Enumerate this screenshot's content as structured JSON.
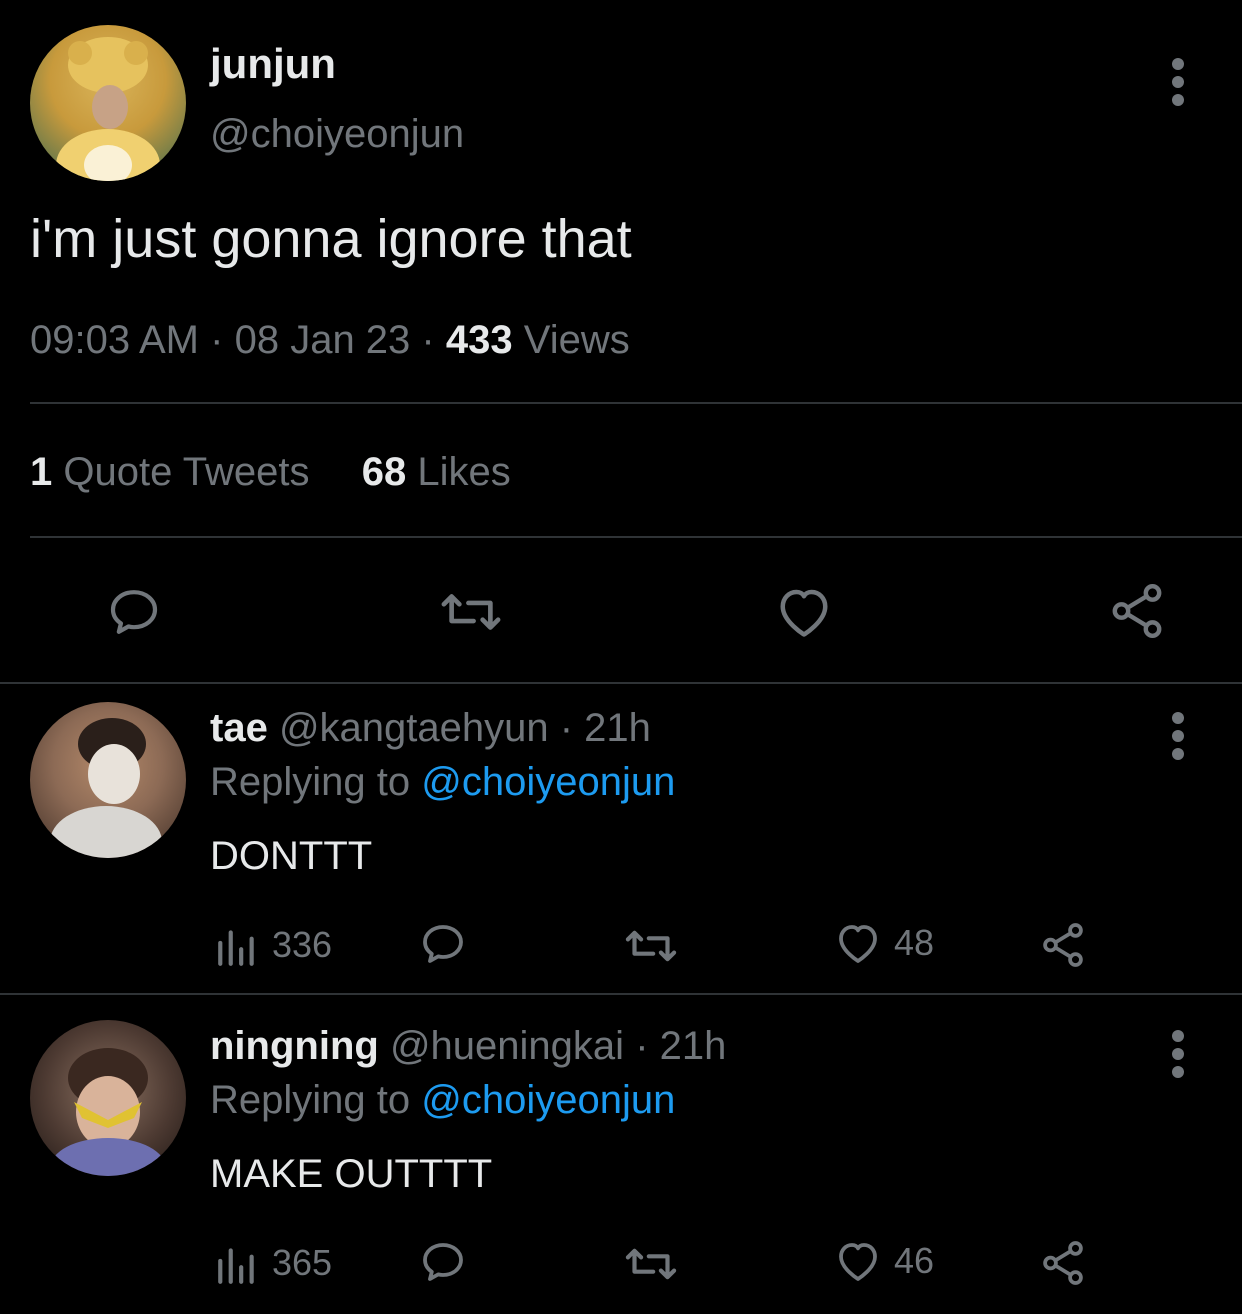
{
  "main_tweet": {
    "display_name": "junjun",
    "handle": "@choiyeonjun",
    "text": "i'm just gonna ignore that",
    "time": "09:03 AM",
    "date": "08 Jan 23",
    "views_count": "433",
    "views_label": "Views",
    "separator": "·",
    "quote_count": "1",
    "quote_label": "Quote Tweets",
    "likes_count": "68",
    "likes_label": "Likes"
  },
  "replies": [
    {
      "display_name": "tae",
      "handle": "@kangtaehyun",
      "time": "· 21h",
      "replying_label": "Replying to",
      "replying_handle": "@choiyeonjun",
      "text": "DONTTT",
      "views": "336",
      "likes": "48"
    },
    {
      "display_name": "ningning",
      "handle": "@hueningkai",
      "time": "· 21h",
      "replying_label": "Replying to",
      "replying_handle": "@choiyeonjun",
      "text": "MAKE OUTTTT",
      "views": "365",
      "likes": "46"
    }
  ],
  "colors": {
    "background": "#000000",
    "text": "#e7e9ea",
    "muted": "#71767b",
    "link": "#1d9bf0",
    "divider": "#2f3336"
  },
  "icons": [
    "more-icon",
    "reply-icon",
    "retweet-icon",
    "like-icon",
    "share-icon",
    "views-icon"
  ]
}
